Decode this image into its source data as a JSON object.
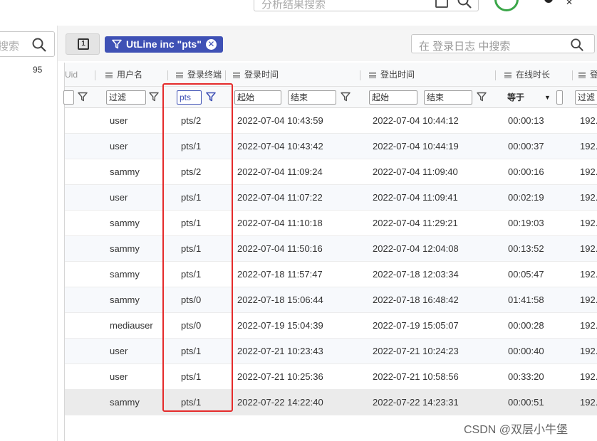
{
  "top": {
    "search_placeholder": "分析结果搜索"
  },
  "left": {
    "search_placeholder": "搜索",
    "count": "95"
  },
  "toolbar": {
    "filter_chip": "UtLine inc \"pts\"",
    "search_placeholder": "在 登录日志 中搜索"
  },
  "columns": {
    "uid": "Uid",
    "user": "用户名",
    "terminal": "登录终端",
    "login": "登录时间",
    "logout": "登出时间",
    "online": "在线时长",
    "ip": "登"
  },
  "filters": {
    "user": "过滤",
    "terminal": "pts",
    "login_start": "起始",
    "login_end": "结束",
    "logout_start": "起始",
    "logout_end": "结束",
    "online_op": "等于",
    "ip": "过滤"
  },
  "rows": [
    {
      "user": "user",
      "terminal": "pts/2",
      "login": "2022-07-04 10:43:59",
      "logout": "2022-07-04 10:44:12",
      "online": "00:00:13",
      "ip": "192."
    },
    {
      "user": "user",
      "terminal": "pts/1",
      "login": "2022-07-04 10:43:42",
      "logout": "2022-07-04 10:44:19",
      "online": "00:00:37",
      "ip": "192."
    },
    {
      "user": "sammy",
      "terminal": "pts/2",
      "login": "2022-07-04 11:09:24",
      "logout": "2022-07-04 11:09:40",
      "online": "00:00:16",
      "ip": "192."
    },
    {
      "user": "user",
      "terminal": "pts/1",
      "login": "2022-07-04 11:07:22",
      "logout": "2022-07-04 11:09:41",
      "online": "00:02:19",
      "ip": "192."
    },
    {
      "user": "sammy",
      "terminal": "pts/1",
      "login": "2022-07-04 11:10:18",
      "logout": "2022-07-04 11:29:21",
      "online": "00:19:03",
      "ip": "192."
    },
    {
      "user": "sammy",
      "terminal": "pts/1",
      "login": "2022-07-04 11:50:16",
      "logout": "2022-07-04 12:04:08",
      "online": "00:13:52",
      "ip": "192."
    },
    {
      "user": "sammy",
      "terminal": "pts/1",
      "login": "2022-07-18 11:57:47",
      "logout": "2022-07-18 12:03:34",
      "online": "00:05:47",
      "ip": "192."
    },
    {
      "user": "sammy",
      "terminal": "pts/0",
      "login": "2022-07-18 15:06:44",
      "logout": "2022-07-18 16:48:42",
      "online": "01:41:58",
      "ip": "192."
    },
    {
      "user": "mediauser",
      "terminal": "pts/0",
      "login": "2022-07-19 15:04:39",
      "logout": "2022-07-19 15:05:07",
      "online": "00:00:28",
      "ip": "192."
    },
    {
      "user": "user",
      "terminal": "pts/1",
      "login": "2022-07-21 10:23:43",
      "logout": "2022-07-21 10:24:23",
      "online": "00:00:40",
      "ip": "192."
    },
    {
      "user": "user",
      "terminal": "pts/1",
      "login": "2022-07-21 10:25:36",
      "logout": "2022-07-21 10:58:56",
      "online": "00:33:20",
      "ip": "192."
    },
    {
      "user": "sammy",
      "terminal": "pts/1",
      "login": "2022-07-22 14:22:40",
      "logout": "2022-07-22 14:23:31",
      "online": "00:00:51",
      "ip": "192."
    }
  ],
  "watermark": "CSDN @双层小牛堡",
  "colors": {
    "accent": "#3f51b5",
    "highlight": "#e52b2b",
    "shield": "#3aa648"
  }
}
